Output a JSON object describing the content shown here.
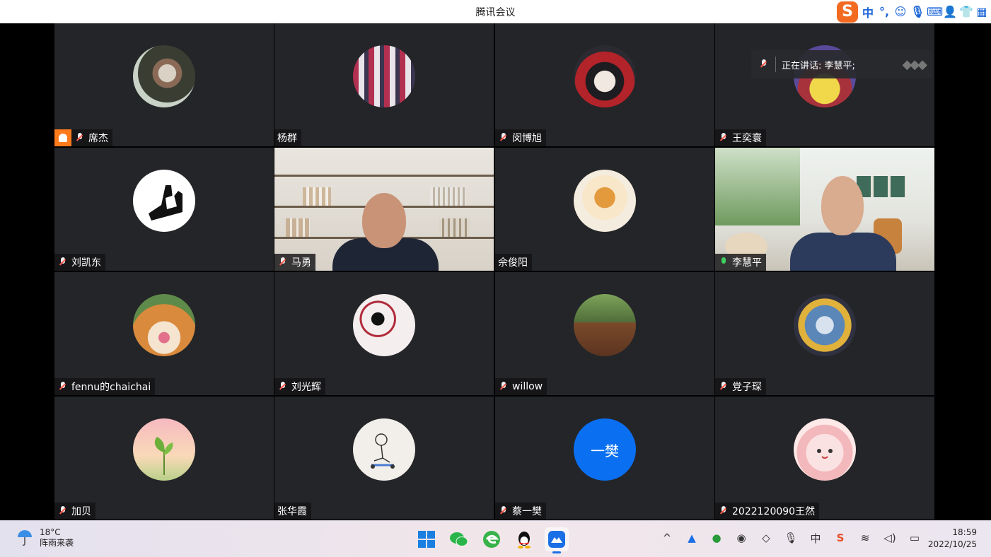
{
  "window": {
    "title": "腾讯会议"
  },
  "ime_toolbar": {
    "logo": "S",
    "items": [
      {
        "name": "chinese-mode",
        "glyph": "中"
      },
      {
        "name": "punctuation",
        "glyph": "°,"
      },
      {
        "name": "emoji-icon",
        "glyph": "☺"
      },
      {
        "name": "voice-icon",
        "glyph": "🎙"
      },
      {
        "name": "keyboard-icon",
        "glyph": "⌨"
      },
      {
        "name": "user-icon",
        "glyph": "👤"
      },
      {
        "name": "skin-icon",
        "glyph": "👕"
      },
      {
        "name": "toolbox-icon",
        "glyph": "▦"
      }
    ]
  },
  "speaking_indicator": {
    "label": "正在讲话: 李慧平;"
  },
  "participants": [
    {
      "name": "席杰",
      "mic": "muted",
      "host": true,
      "avatar": "photo"
    },
    {
      "name": "杨群",
      "mic": "none",
      "avatar": "photo"
    },
    {
      "name": "闵博旭",
      "mic": "muted",
      "avatar": "photo"
    },
    {
      "name": "王奕寰",
      "mic": "muted",
      "avatar": "photo"
    },
    {
      "name": "刘凯东",
      "mic": "muted",
      "avatar": "photo"
    },
    {
      "name": "马勇",
      "mic": "muted",
      "video": "shelf"
    },
    {
      "name": "佘俊阳",
      "mic": "none",
      "avatar": "photo"
    },
    {
      "name": "李慧平",
      "mic": "on",
      "video": "room",
      "active": true
    },
    {
      "name": "fennu的chaichai",
      "mic": "muted",
      "avatar": "photo"
    },
    {
      "name": "刘光辉",
      "mic": "muted",
      "avatar": "photo"
    },
    {
      "name": "willow",
      "mic": "muted",
      "avatar": "photo"
    },
    {
      "name": "党子琛",
      "mic": "muted",
      "avatar": "photo"
    },
    {
      "name": "加贝",
      "mic": "muted",
      "avatar": "photo"
    },
    {
      "name": "张华霞",
      "mic": "none",
      "avatar": "photo"
    },
    {
      "name": "蔡一樊",
      "mic": "muted",
      "avatar": "text",
      "avatar_text": "一樊"
    },
    {
      "name": "2022120090王然",
      "mic": "muted",
      "avatar": "photo"
    }
  ],
  "taskbar": {
    "weather": {
      "temp": "18°C",
      "desc": "阵雨来袭"
    },
    "apps": [
      {
        "name": "windows-start",
        "active": false
      },
      {
        "name": "wechat",
        "active": false
      },
      {
        "name": "edge",
        "active": false
      },
      {
        "name": "qq",
        "active": false
      },
      {
        "name": "tencent-meeting",
        "active": true
      }
    ],
    "tray": [
      "^",
      "会",
      "🎨",
      "🐧",
      "🔔",
      "🎙",
      "中",
      "S",
      "📶",
      "🔈",
      "🔋"
    ],
    "clock": {
      "time": "18:59",
      "date": "2022/10/25"
    }
  }
}
